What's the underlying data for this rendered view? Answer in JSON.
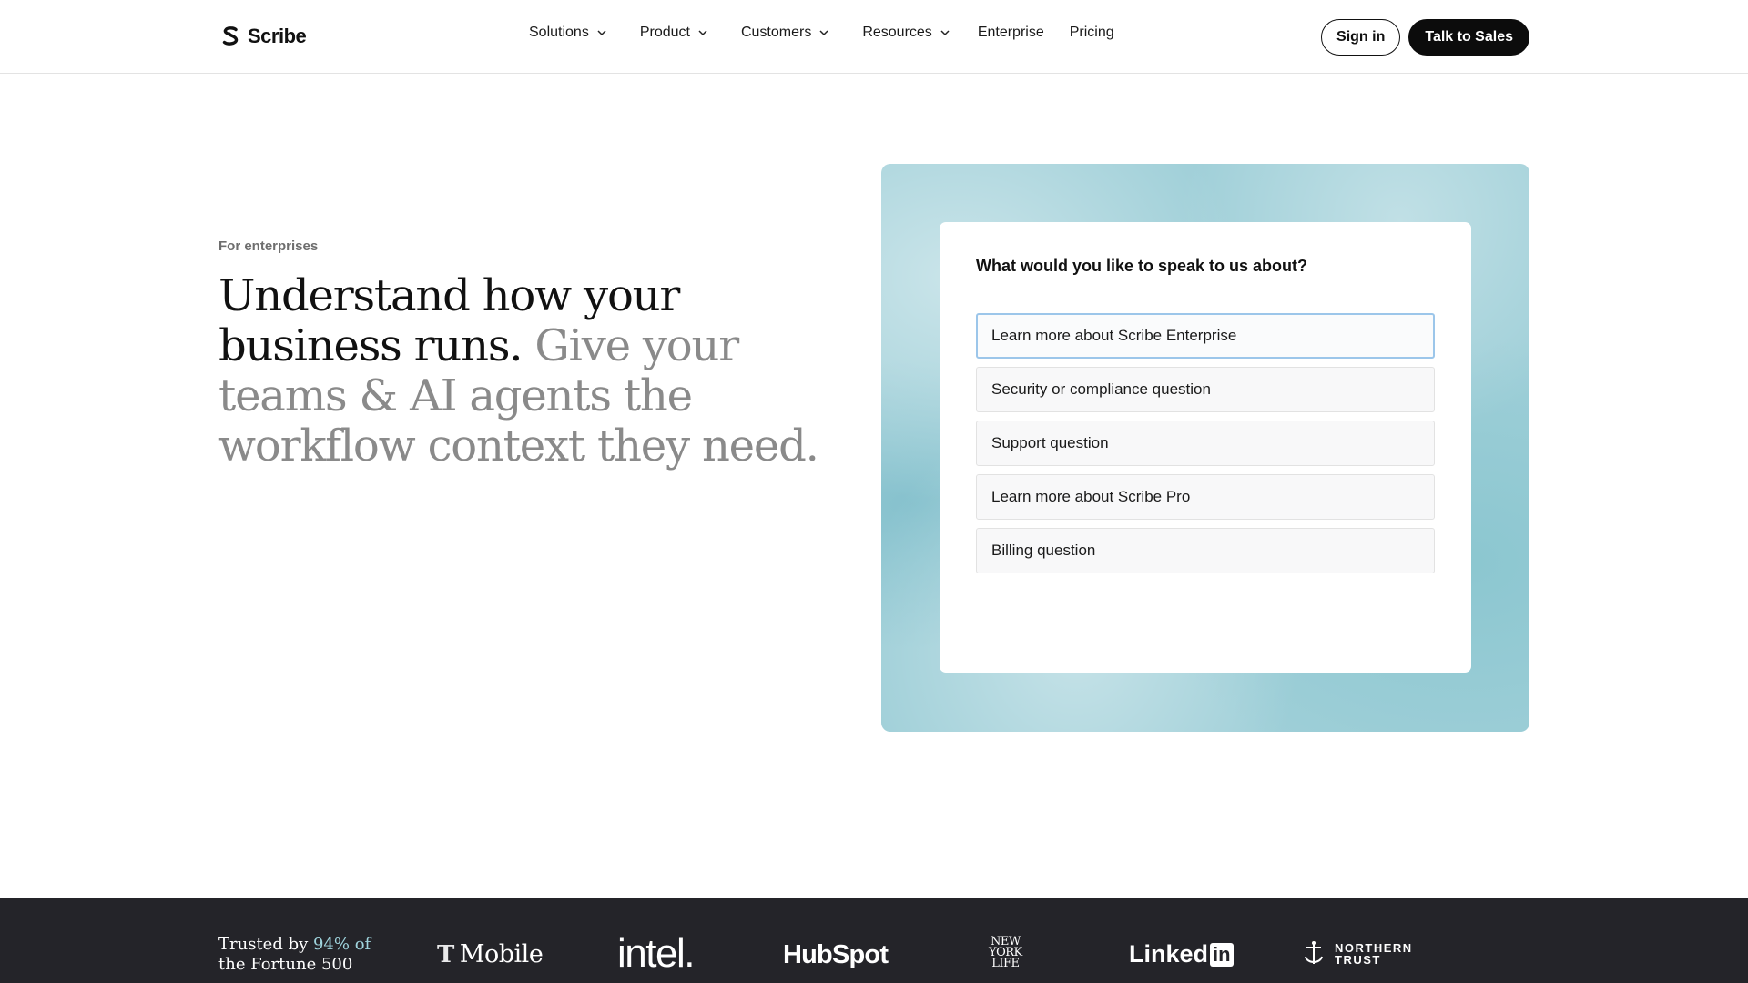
{
  "nav": {
    "logo_text": "Scribe",
    "items": [
      {
        "label": "Solutions",
        "has_dropdown": true
      },
      {
        "label": "Product",
        "has_dropdown": true
      },
      {
        "label": "Customers",
        "has_dropdown": true
      },
      {
        "label": "Resources",
        "has_dropdown": true
      },
      {
        "label": "Enterprise",
        "has_dropdown": false
      },
      {
        "label": "Pricing",
        "has_dropdown": false
      }
    ],
    "sign_in": "Sign in",
    "talk_to_sales": "Talk to Sales"
  },
  "hero": {
    "eyebrow": "For enterprises",
    "headline_dark": "Understand how your business runs.",
    "headline_muted": "Give your teams & AI agents the workflow context they need."
  },
  "form": {
    "question": "What would you like to speak to us about?",
    "options": [
      "Learn more about Scribe Enterprise",
      "Security or compliance question",
      "Support question",
      "Learn more about Scribe Pro",
      "Billing question"
    ],
    "selected_index": 0
  },
  "trust": {
    "text_prefix": "Trusted by ",
    "highlight": "94% of",
    "text_suffix": "the Fortune 500",
    "brands": {
      "tmobile": "Mobile",
      "tmobile_mark": "T",
      "intel": "intel.",
      "hubspot": "HubSpot",
      "nyl_1": "NEW",
      "nyl_2": "YORK",
      "nyl_3": "LIFE",
      "linkedin": "Linked",
      "linkedin_in": "in",
      "ntrust_1": "NORTHERN",
      "ntrust_2": "TRUST"
    }
  },
  "colors": {
    "panel_bg": "#9fcfd8",
    "footer_bg": "#242429",
    "active_option_border": "#9cc6ea",
    "highlight_text": "#9fd4dd"
  }
}
